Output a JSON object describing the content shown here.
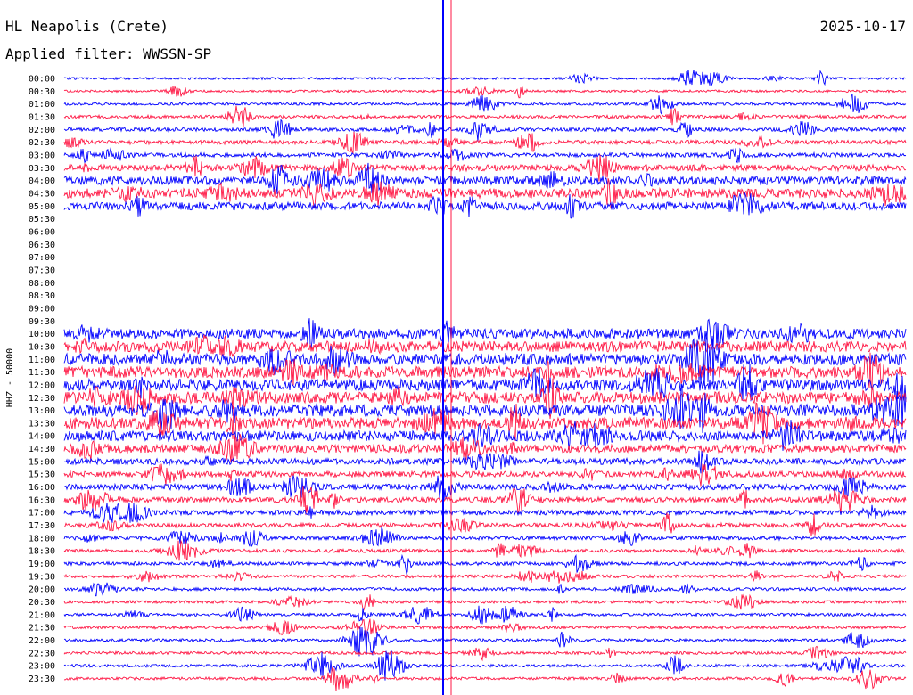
{
  "header": {
    "station": "HL Neapolis (Crete)",
    "date": "2025-10-17",
    "filter": "Applied filter: WWSSN-SP"
  },
  "colors": {
    "trace_a": "#0000ff",
    "trace_b": "#ff1744",
    "marker": "#0000ff",
    "marker_b": "#ff1744",
    "text": "#000000",
    "background": "#ffffff"
  },
  "chart_data": {
    "type": "line",
    "ylabel": "HHZ - 50000",
    "hour_labels": [
      "00:00",
      "00:30",
      "01:00",
      "01:30",
      "02:00",
      "02:30",
      "03:00",
      "03:30",
      "04:00",
      "04:30",
      "05:00",
      "05:30",
      "06:00",
      "06:30",
      "07:00",
      "07:30",
      "08:00",
      "08:30",
      "09:00",
      "09:30",
      "10:00",
      "10:30",
      "11:00",
      "11:30",
      "12:00",
      "12:30",
      "13:00",
      "13:30",
      "14:00",
      "14:30",
      "15:00",
      "15:30",
      "16:00",
      "16:30",
      "17:00",
      "17:30",
      "18:00",
      "18:30",
      "19:00",
      "19:30",
      "20:00",
      "20:30",
      "21:00",
      "21:30",
      "22:00",
      "22:30",
      "23:00",
      "23:30"
    ],
    "trace_colors": [
      "trace_a",
      "trace_b"
    ],
    "line_activity": [
      0.8,
      0.8,
      0.9,
      1.1,
      1.3,
      1.4,
      1.5,
      2.2,
      3.0,
      3.3,
      2.8,
      0,
      0,
      0,
      0,
      0,
      0,
      0,
      0,
      0,
      3.5,
      3.8,
      4.0,
      4.0,
      4.0,
      4.0,
      4.2,
      4.0,
      3.6,
      2.8,
      2.2,
      2.0,
      2.0,
      1.9,
      1.7,
      1.5,
      1.3,
      1.2,
      1.2,
      1.1,
      1.1,
      1.0,
      1.0,
      1.0,
      1.0,
      1.0,
      1.0,
      1.0
    ],
    "grid": false
  }
}
